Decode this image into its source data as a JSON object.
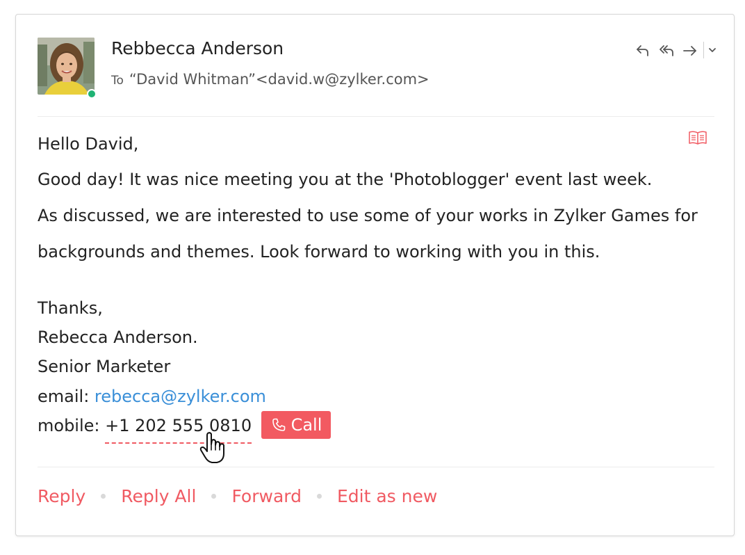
{
  "sender": {
    "name": "Rebbecca Anderson",
    "online": true
  },
  "recipient": {
    "to_label": "To",
    "address": "“David Whitman”<david.w@zylker.com>"
  },
  "header_actions": [
    "reply-icon",
    "reply-all-icon",
    "forward-icon",
    "chevron-down-icon"
  ],
  "body": {
    "greeting": "Hello David,",
    "line1": "Good day! It was nice meeting you at the 'Photoblogger' event last week.",
    "line2": "As discussed, we are interested to use some of your works in Zylker Games for",
    "line3": "backgrounds and themes. Look forward to working with you in this.",
    "closing": "Thanks,",
    "signature_name": "Rebecca Anderson.",
    "signature_title": "Senior Marketer",
    "email_label": "email: ",
    "email_value": "rebecca@zylker.com",
    "mobile_label": "mobile: ",
    "mobile_value": "+1 202 555 0810",
    "call_label": "Call"
  },
  "footer": {
    "reply": "Reply",
    "reply_all": "Reply All",
    "forward": "Forward",
    "edit_as_new": "Edit as new"
  },
  "colors": {
    "accent": "#f05a62",
    "link": "#3a8fd8",
    "presence": "#1fb374",
    "border": "#d6d6d6"
  }
}
